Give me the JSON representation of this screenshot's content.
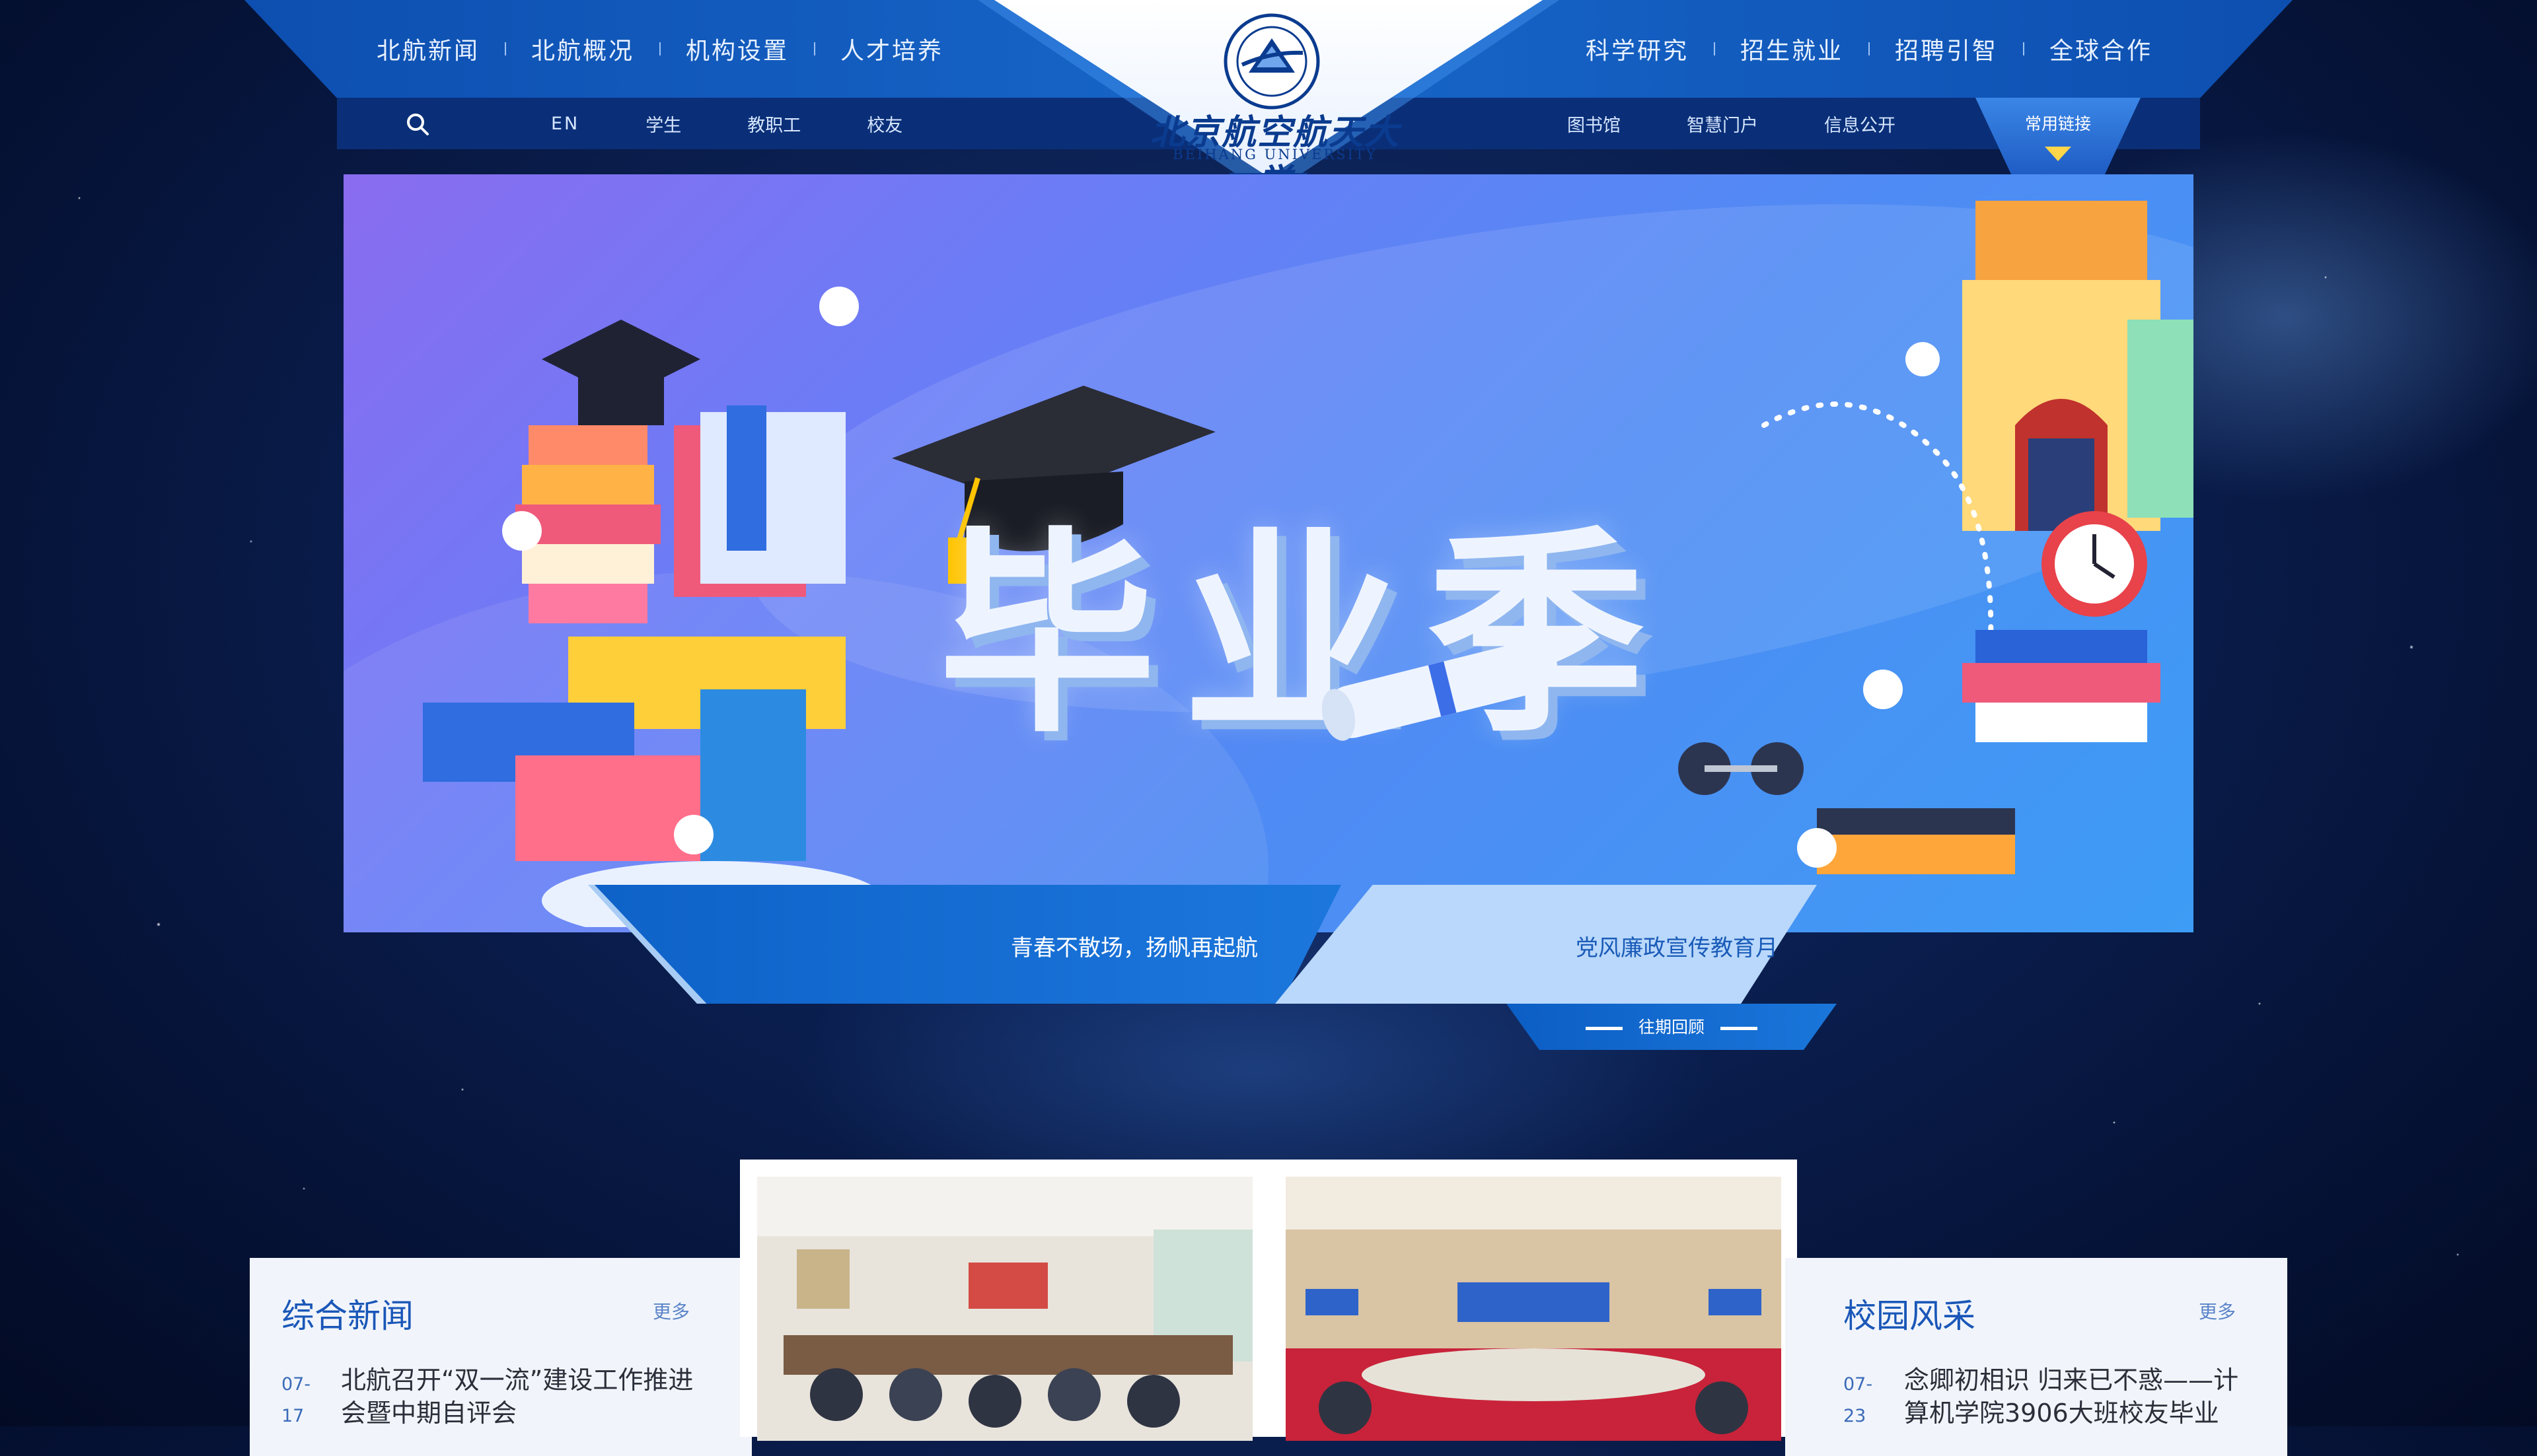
{
  "header": {
    "nav_left": [
      "北航新闻",
      "北航概况",
      "机构设置",
      "人才培养"
    ],
    "nav_right": [
      "科学研究",
      "招生就业",
      "招聘引智",
      "全球合作"
    ],
    "sub_left": [
      "EN",
      "学生",
      "教职工",
      "校友"
    ],
    "sub_right": [
      "图书馆",
      "智慧门户",
      "信息公开"
    ],
    "links_label": "常用链接",
    "logo_cn": "北京航空航天大学",
    "logo_en": "BEIHANG UNIVERSITY"
  },
  "banner": {
    "title": "毕业季",
    "tab_active": "青春不散场，扬帆再起航",
    "tab_other": "党风廉政宣传教育月",
    "past_label": "往期回顾"
  },
  "news_left": {
    "title": "综合新闻",
    "more": "更多",
    "items": [
      {
        "date_md": "07-",
        "date_d": "17",
        "text1": "北航召开“双一流”建设工作推进",
        "text2": "会暨中期自评会"
      }
    ]
  },
  "news_right": {
    "title": "校园风采",
    "more": "更多",
    "items": [
      {
        "date_md": "07-",
        "date_d": "23",
        "text1": "念卿初相识 归来已不惑——计",
        "text2": "算机学院3906大班校友毕业"
      }
    ]
  },
  "colors": {
    "nav_blue": "#1766c9",
    "subbar": "#0a2f78",
    "accent": "#1a57b8",
    "links_caret": "#ffd54a"
  }
}
